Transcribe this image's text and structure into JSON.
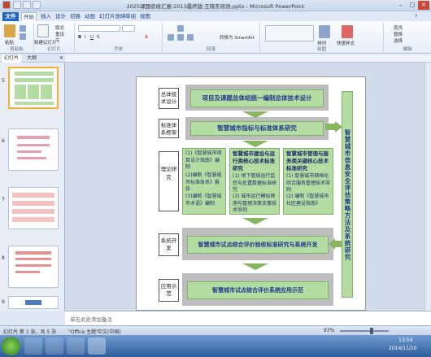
{
  "window": {
    "title": "2025课题验收汇报·2013最终版·王晓东修改.pptx - Microsoft PowerPoint",
    "controls": [
      "–",
      "□",
      "✕"
    ]
  },
  "ribbon_tabs": [
    {
      "label": "文件",
      "key": "file"
    },
    {
      "label": "开始",
      "key": "home"
    },
    {
      "label": "插入",
      "key": "insert"
    },
    {
      "label": "设计",
      "key": "design"
    },
    {
      "label": "切换",
      "key": "transitions"
    },
    {
      "label": "动画",
      "key": "animations"
    },
    {
      "label": "幻灯片放映",
      "key": "slideshow"
    },
    {
      "label": "审阅",
      "key": "review"
    },
    {
      "label": "视图",
      "key": "view"
    }
  ],
  "ribbon_groups": {
    "clipboard": {
      "label": "剪贴板",
      "paste": "粘贴"
    },
    "slides": {
      "label": "幻灯片",
      "new_slide": "新建幻灯片",
      "layout": "版式",
      "reset": "重设",
      "section": "节"
    },
    "font": {
      "label": "字体"
    },
    "paragraph": {
      "label": "段落",
      "smartart": "转换为 SmartArt"
    },
    "drawing": {
      "label": "绘图",
      "arrange": "排列",
      "quick_styles": "快速样式"
    },
    "editing": {
      "label": "编辑",
      "find": "查找",
      "replace": "替换",
      "select": "选择"
    }
  },
  "left_pane": {
    "tabs": [
      "幻灯片",
      "大纲"
    ],
    "thumbs": [
      "5",
      "6",
      "7",
      "8",
      "9"
    ]
  },
  "slide": {
    "rows": [
      {
        "label": "总体技术设计",
        "box": "项目及课题总体组统一编制总体技术设计"
      },
      {
        "label": "标准体系框架",
        "box": "智慧城市指标与标准体系研究"
      },
      {
        "label": "理论研究",
        "box": ""
      },
      {
        "label": "系统开发",
        "box": "智慧城市试点综合评价验收标准研究与系统开发"
      },
      {
        "label": "应用示范",
        "box": "智慧城市试点综合评价系统应用示范"
      }
    ],
    "col1": {
      "items": [
        "(1)《智慧城市项目设计指南》编制",
        "(2)编制《智慧城市标准体系》报告",
        "(3)编制《智慧城市术语》编制"
      ]
    },
    "col2": {
      "title": "智慧城市建设与运行类核心技术标准研究",
      "items": [
        "(1) 地下管线运行监控与处置数据标准研究",
        "(2) 城市运行模拟预测与管理决策支撑技术导则"
      ]
    },
    "col3": {
      "title": "智慧城市管理与服务类关键核心技术标准研究",
      "items": [
        "(1) 智慧城市网格化综合服务管理技术导则",
        "(2) 编制《智慧城市社区建设指南》"
      ]
    },
    "right_box": "智慧城市信息安全评估策略方法及系统研究"
  },
  "notes": {
    "placeholder": "单击此处添加备注"
  },
  "status": {
    "slide_info": "幻灯片 第 1 张，共 5 张",
    "theme": "\"Office 主题\"",
    "lang": "中文(中国)",
    "zoom": "93%"
  },
  "clock": {
    "time": "13:54",
    "date": "2014/11/10"
  },
  "colors": {
    "box_green": "#b5dda3",
    "text_blue": "#1f3b8a",
    "arrow_green": "#86b75f",
    "file_tab": "#1f66c4"
  }
}
